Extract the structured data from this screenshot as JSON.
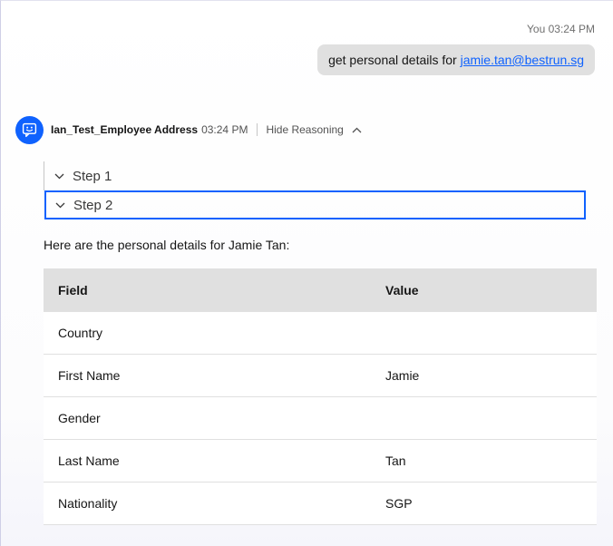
{
  "user_message": {
    "author": "You",
    "time": "03:24 PM",
    "text_prefix": "get personal details for ",
    "email": "jamie.tan@bestrun.sg"
  },
  "bot": {
    "name": "Ian_Test_Employee Address",
    "time": "03:24 PM",
    "reasoning_toggle": "Hide Reasoning",
    "steps": [
      "Step 1",
      "Step 2"
    ],
    "intro": "Here are the personal details for Jamie Tan:",
    "table": {
      "headers": [
        "Field",
        "Value"
      ],
      "rows": [
        [
          "Country",
          ""
        ],
        [
          "First Name",
          "Jamie"
        ],
        [
          "Gender",
          ""
        ],
        [
          "Last Name",
          "Tan"
        ],
        [
          "Nationality",
          "SGP"
        ]
      ]
    }
  },
  "colors": {
    "accent": "#0f62fe",
    "bubble": "#e0e0e0",
    "header_row": "#e0e0e0"
  },
  "icons": {
    "avatar": "chat-bot-icon",
    "toggle": "chevron-up-icon",
    "step": "chevron-down-icon"
  }
}
